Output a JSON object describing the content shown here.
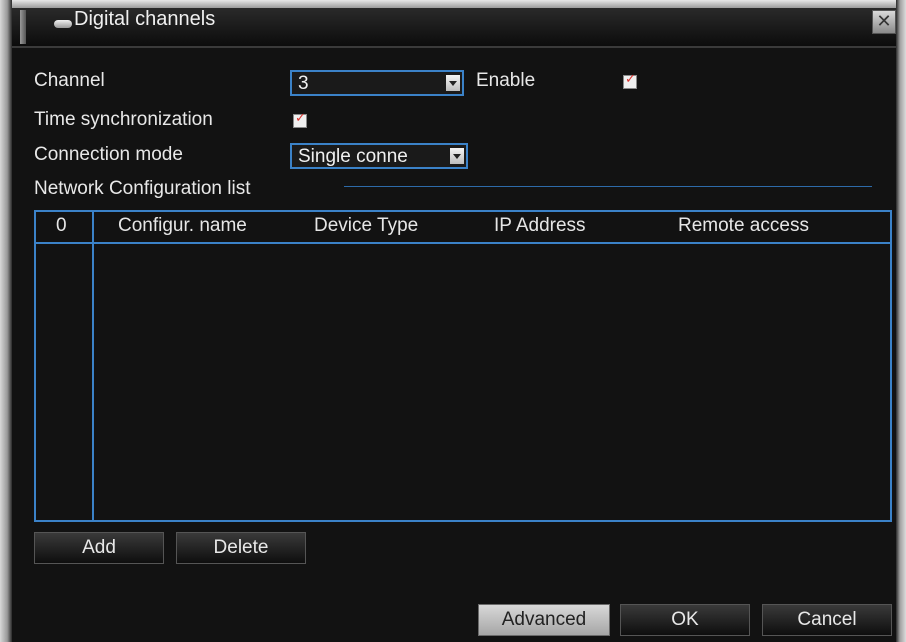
{
  "window": {
    "title": "Digital channels",
    "close_glyph": "✕"
  },
  "form": {
    "channel_label": "Channel",
    "channel_value": "3",
    "enable_label": "Enable",
    "enable_checked": true,
    "time_sync_label": "Time synchronization",
    "time_sync_checked": true,
    "connection_mode_label": "Connection mode",
    "connection_mode_value": "Single conne"
  },
  "network_list": {
    "title": "Network Configuration list",
    "columns": [
      "0",
      "Configur. name",
      "Device Type",
      "IP Address",
      "Remote access"
    ],
    "rows": []
  },
  "buttons": {
    "add": "Add",
    "delete": "Delete",
    "advanced": "Advanced",
    "ok": "OK",
    "cancel": "Cancel"
  },
  "colors": {
    "accent": "#3b82c8",
    "check": "#d8342f",
    "background": "#121212"
  },
  "icons": {
    "title_icon": "window-icon",
    "close": "close-icon",
    "dropdown": "chevron-down-icon",
    "check": "checkmark-icon"
  }
}
